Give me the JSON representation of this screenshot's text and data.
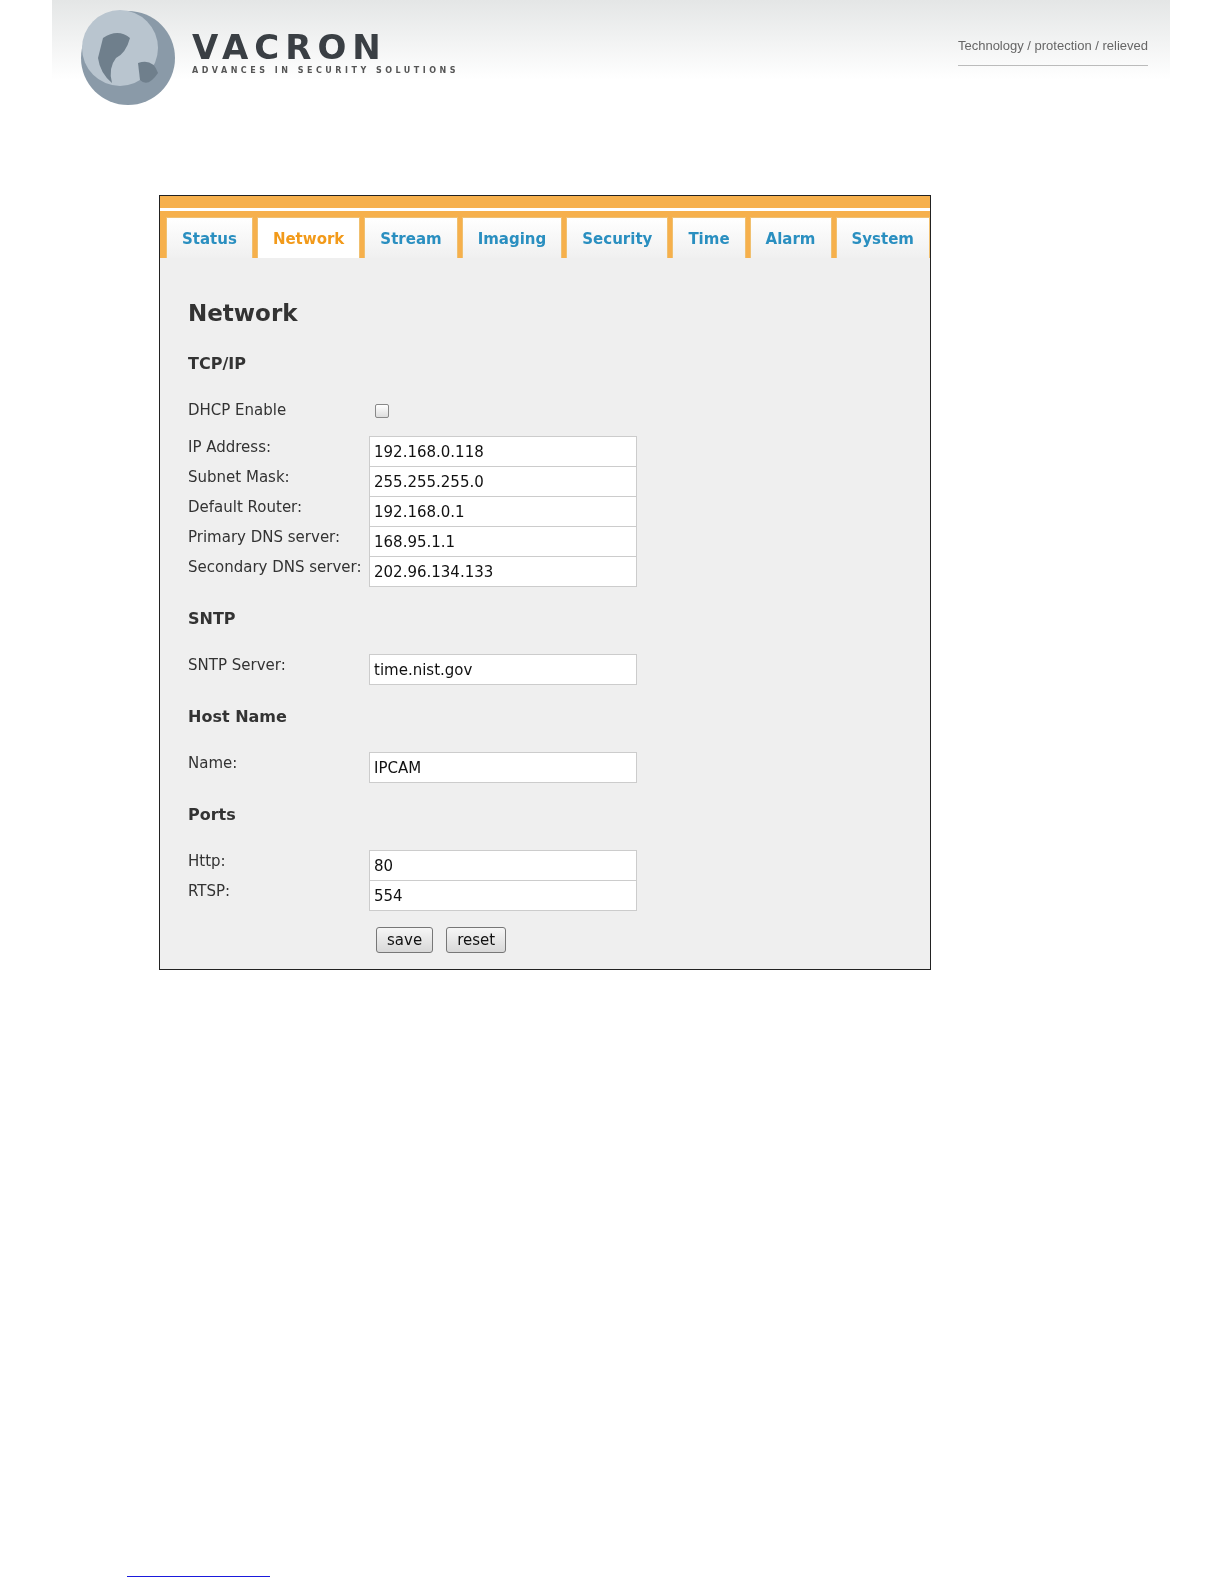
{
  "header": {
    "logo": "VACRON",
    "logo_subtitle": "ADVANCES IN SECURITY SOLUTIONS",
    "tagline": "Technology / protection / relieved"
  },
  "tabs": [
    {
      "label": "Status",
      "selected": false
    },
    {
      "label": "Network",
      "selected": true
    },
    {
      "label": "Stream",
      "selected": false
    },
    {
      "label": "Imaging",
      "selected": false
    },
    {
      "label": "Security",
      "selected": false
    },
    {
      "label": "Time",
      "selected": false
    },
    {
      "label": "Alarm",
      "selected": false
    },
    {
      "label": "System",
      "selected": false
    }
  ],
  "page_title": "Network",
  "sections": [
    {
      "title": "TCP/IP",
      "rows": [
        {
          "kind": "checkbox",
          "label": "DHCP Enable",
          "checked": false
        },
        {
          "kind": "text",
          "label": "IP Address:",
          "value": "192.168.0.118"
        },
        {
          "kind": "text",
          "label": "Subnet Mask:",
          "value": "255.255.255.0"
        },
        {
          "kind": "text",
          "label": "Default Router:",
          "value": "192.168.0.1"
        },
        {
          "kind": "text",
          "label": "Primary DNS server:",
          "value": "168.95.1.1"
        },
        {
          "kind": "text",
          "label": "Secondary DNS server:",
          "value": "202.96.134.133"
        }
      ]
    },
    {
      "title": "SNTP",
      "rows": [
        {
          "kind": "text",
          "label": "SNTP Server:",
          "value": "time.nist.gov"
        }
      ]
    },
    {
      "title": "Host Name",
      "rows": [
        {
          "kind": "text",
          "label": "Name:",
          "value": "IPCAM"
        }
      ]
    },
    {
      "title": "Ports",
      "rows": [
        {
          "kind": "text",
          "label": "Http:",
          "value": "80"
        },
        {
          "kind": "text",
          "label": "RTSP:",
          "value": "554"
        }
      ]
    }
  ],
  "buttons": [
    "save",
    "reset"
  ]
}
